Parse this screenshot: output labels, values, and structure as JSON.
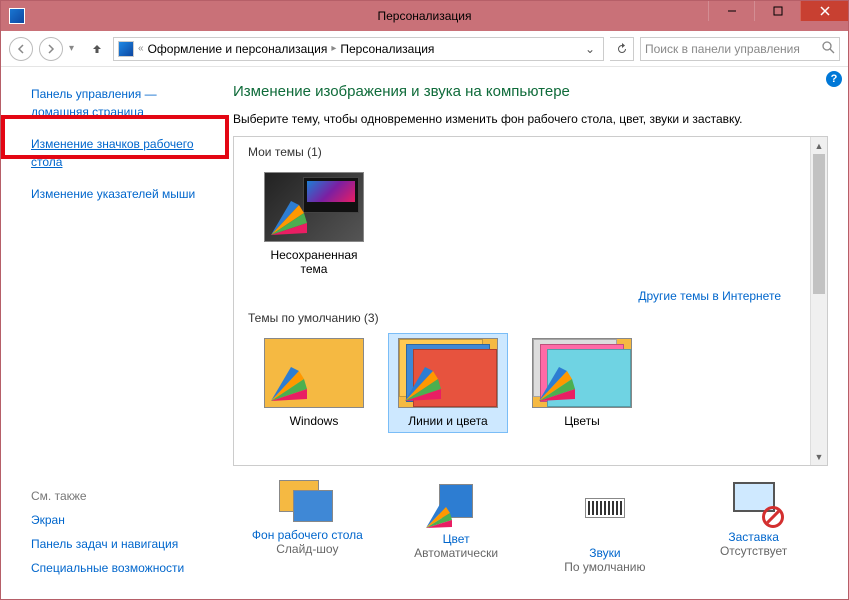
{
  "window": {
    "title": "Персонализация"
  },
  "nav": {
    "crumb_prefix": "«",
    "crumb1": "Оформление и персонализация",
    "crumb2": "Персонализация",
    "search_placeholder": "Поиск в панели управления"
  },
  "sidebar": {
    "home1": "Панель управления —",
    "home2": "домашняя страница",
    "link_icons": "Изменение значков рабочего стола",
    "link_pointers": "Изменение указателей мыши",
    "see_also_title": "См. также",
    "see_also": [
      "Экран",
      "Панель задач и навигация",
      "Специальные возможности"
    ]
  },
  "main": {
    "heading": "Изменение изображения и звука на компьютере",
    "subtext": "Выберите тему, чтобы одновременно изменить фон рабочего стола, цвет, звуки и заставку.",
    "my_themes_title": "Мои темы (1)",
    "my_theme_label": "Несохраненная тема",
    "more_themes": "Другие темы в Интернете",
    "default_themes_title": "Темы по умолчанию (3)",
    "default_themes": [
      "Windows",
      "Линии и цвета",
      "Цветы"
    ],
    "selected_index": 1
  },
  "bottom": {
    "items": [
      {
        "label": "Фон рабочего стола",
        "desc": "Слайд-шоу"
      },
      {
        "label": "Цвет",
        "desc": "Автоматически"
      },
      {
        "label": "Звуки",
        "desc": "По умолчанию"
      },
      {
        "label": "Заставка",
        "desc": "Отсутствует"
      }
    ]
  }
}
